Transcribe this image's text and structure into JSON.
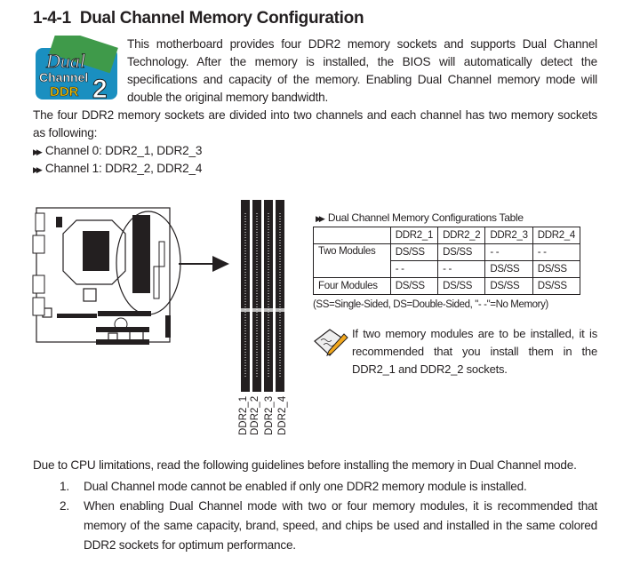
{
  "heading": {
    "number": "1-4-1",
    "title": "Dual Channel Memory Configuration"
  },
  "logo": {
    "line1": "Dual",
    "line2": "Channel",
    "line3": "DDR",
    "line4": "2"
  },
  "intro": "This motherboard provides four DDR2 memory sockets and supports Dual Channel Technology. After the memory is installed, the BIOS will automatically detect the specifications and capacity of the memory. Enabling Dual Channel memory mode will double the original memory bandwidth.",
  "channels_intro": "The four DDR2 memory sockets are divided into two channels and each channel has two memory sockets as following:",
  "channels": [
    "Channel 0: DDR2_1, DDR2_3",
    "Channel 1: DDR2_2, DDR2_4"
  ],
  "slot_labels": [
    "DDR2_1",
    "DDR2_2",
    "DDR2_3",
    "DDR2_4"
  ],
  "table": {
    "title": "Dual Channel Memory Configurations Table",
    "headers": [
      "",
      "DDR2_1",
      "DDR2_2",
      "DDR2_3",
      "DDR2_4"
    ],
    "rows": [
      {
        "label": "Two Modules",
        "cells": [
          "DS/SS",
          "DS/SS",
          "- -",
          "- -"
        ]
      },
      {
        "label": "",
        "cells": [
          "- -",
          "- -",
          "DS/SS",
          "DS/SS"
        ]
      },
      {
        "label": "Four Modules",
        "cells": [
          "DS/SS",
          "DS/SS",
          "DS/SS",
          "DS/SS"
        ]
      }
    ],
    "legend": "(SS=Single-Sided, DS=Double-Sided, \"- -\"=No Memory)"
  },
  "note": "If two memory modules are to be installed, it is recommended that you install them in the DDR2_1 and DDR2_2 sockets.",
  "guidelines_intro": "Due to CPU limitations, read the following guidelines before installing the memory in Dual Channel mode.",
  "guidelines": [
    {
      "num": "1.",
      "text": "Dual Channel mode cannot be enabled if only one DDR2 memory module is installed."
    },
    {
      "num": "2.",
      "text": "When enabling Dual Channel mode with two or four memory modules, it is recommended that memory of the same capacity, brand, speed, and chips be used and installed in the same colored DDR2 sockets for optimum performance."
    }
  ]
}
